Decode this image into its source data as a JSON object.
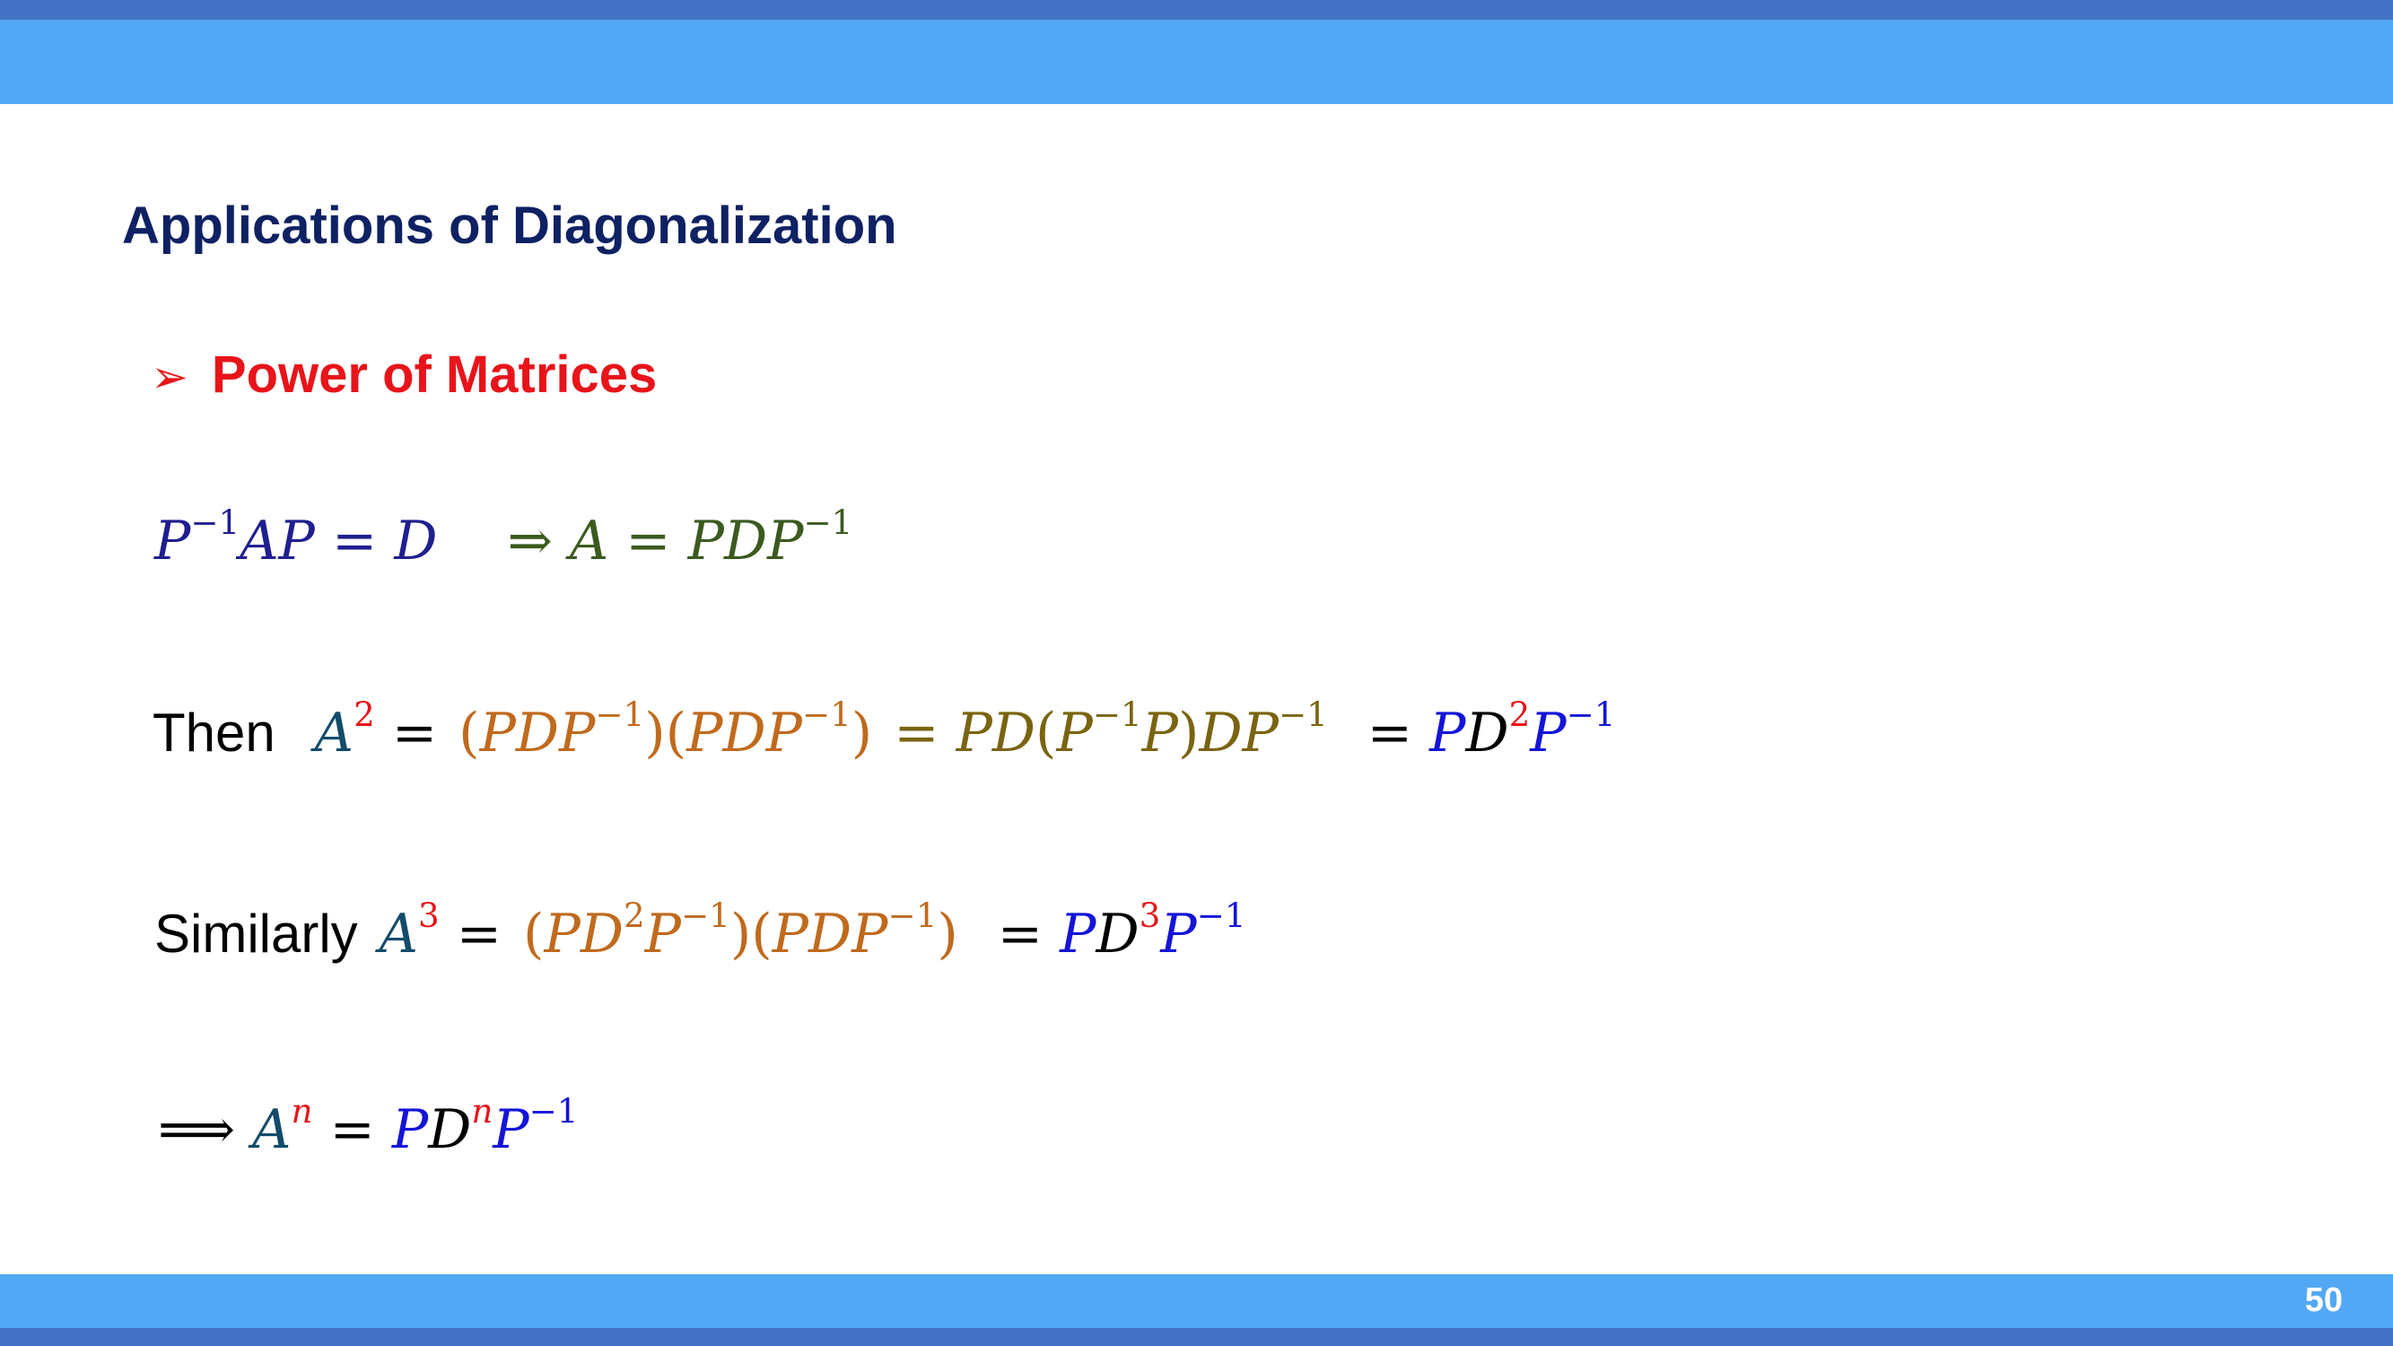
{
  "slide": {
    "title": "Applications of Diagonalization",
    "bullet": "Power of Matrices",
    "page_number": "50"
  },
  "labels": {
    "then": "Then",
    "similarly": "Similarly"
  },
  "sym": {
    "P": "P",
    "A": "A",
    "D": "D",
    "eq": "=",
    "implies": "⇒",
    "long_implies": "⟹",
    "lp": "(",
    "rp": ")",
    "inv": "−1",
    "two": "2",
    "three": "3",
    "n": "n",
    "pdp": "PDP",
    "pd": "PD",
    "dp": "DP",
    "ap": "AP"
  },
  "colors": {
    "title": "#0e2163",
    "bullet": "#e8141a",
    "band": "#53a8f5",
    "band_edge": "#4472c4"
  }
}
